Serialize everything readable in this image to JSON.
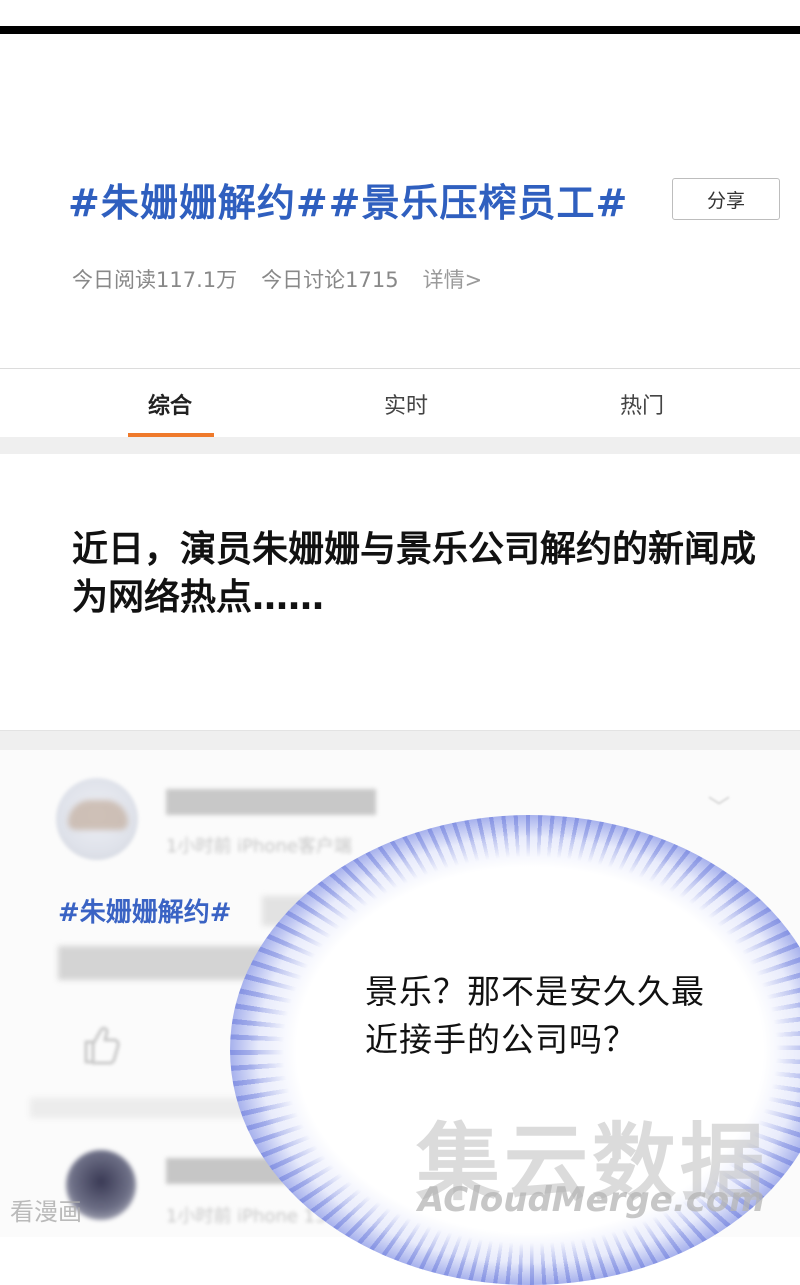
{
  "topic": {
    "title": "#朱姗姗解约##景乐压榨员工#",
    "share_label": "分享",
    "reads": "今日阅读117.1万",
    "discussions": "今日讨论1715",
    "detail_link": "详情>"
  },
  "tabs": [
    {
      "label": "综合",
      "active": true
    },
    {
      "label": "实时",
      "active": false
    },
    {
      "label": "热门",
      "active": false
    }
  ],
  "caption": "近日，演员朱姗姗与景乐公司解约的新闻成为网络热点……",
  "post": {
    "hashtag": "#朱姗姗解约#",
    "meta_1": "1小时前   iPhone客户端",
    "meta_2": "1小时前   iPhone 13"
  },
  "speech_bubble": "景乐？那不是安久久最近接手的公司吗？",
  "watermarks": {
    "logo_cn": "集云数据",
    "logo_en": "ACloudMerge.com",
    "site": "看漫画"
  },
  "colors": {
    "hashtag_blue": "#2f5fbf",
    "tab_underline": "#ef7a2b",
    "burst_blue": "#6a79d9"
  }
}
